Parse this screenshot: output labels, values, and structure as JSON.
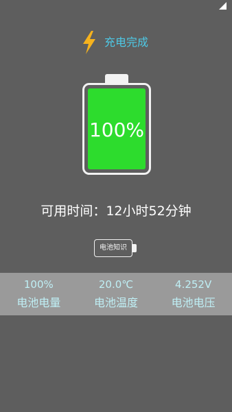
{
  "charge_status": "充电完成",
  "battery": {
    "percent_label": "100%",
    "level": 1.0
  },
  "remaining_time": "可用时间：12小时52分钟",
  "knowledge_button_label": "电池知识",
  "stats": [
    {
      "value": "100%",
      "label": "电池电量"
    },
    {
      "value": "20.0℃",
      "label": "电池温度"
    },
    {
      "value": "4.252V",
      "label": "电池电压"
    }
  ],
  "colors": {
    "background": "#5e5e5e",
    "accent": "#4ec9e6",
    "bolt": "#f5b21e",
    "battery_fill": "#2ddc2d",
    "stats_bar": "#9a9a9a",
    "stats_text": "#bfeff5"
  },
  "icons": {
    "charge": "lightning-bolt-icon",
    "signal": "signal-icon"
  }
}
